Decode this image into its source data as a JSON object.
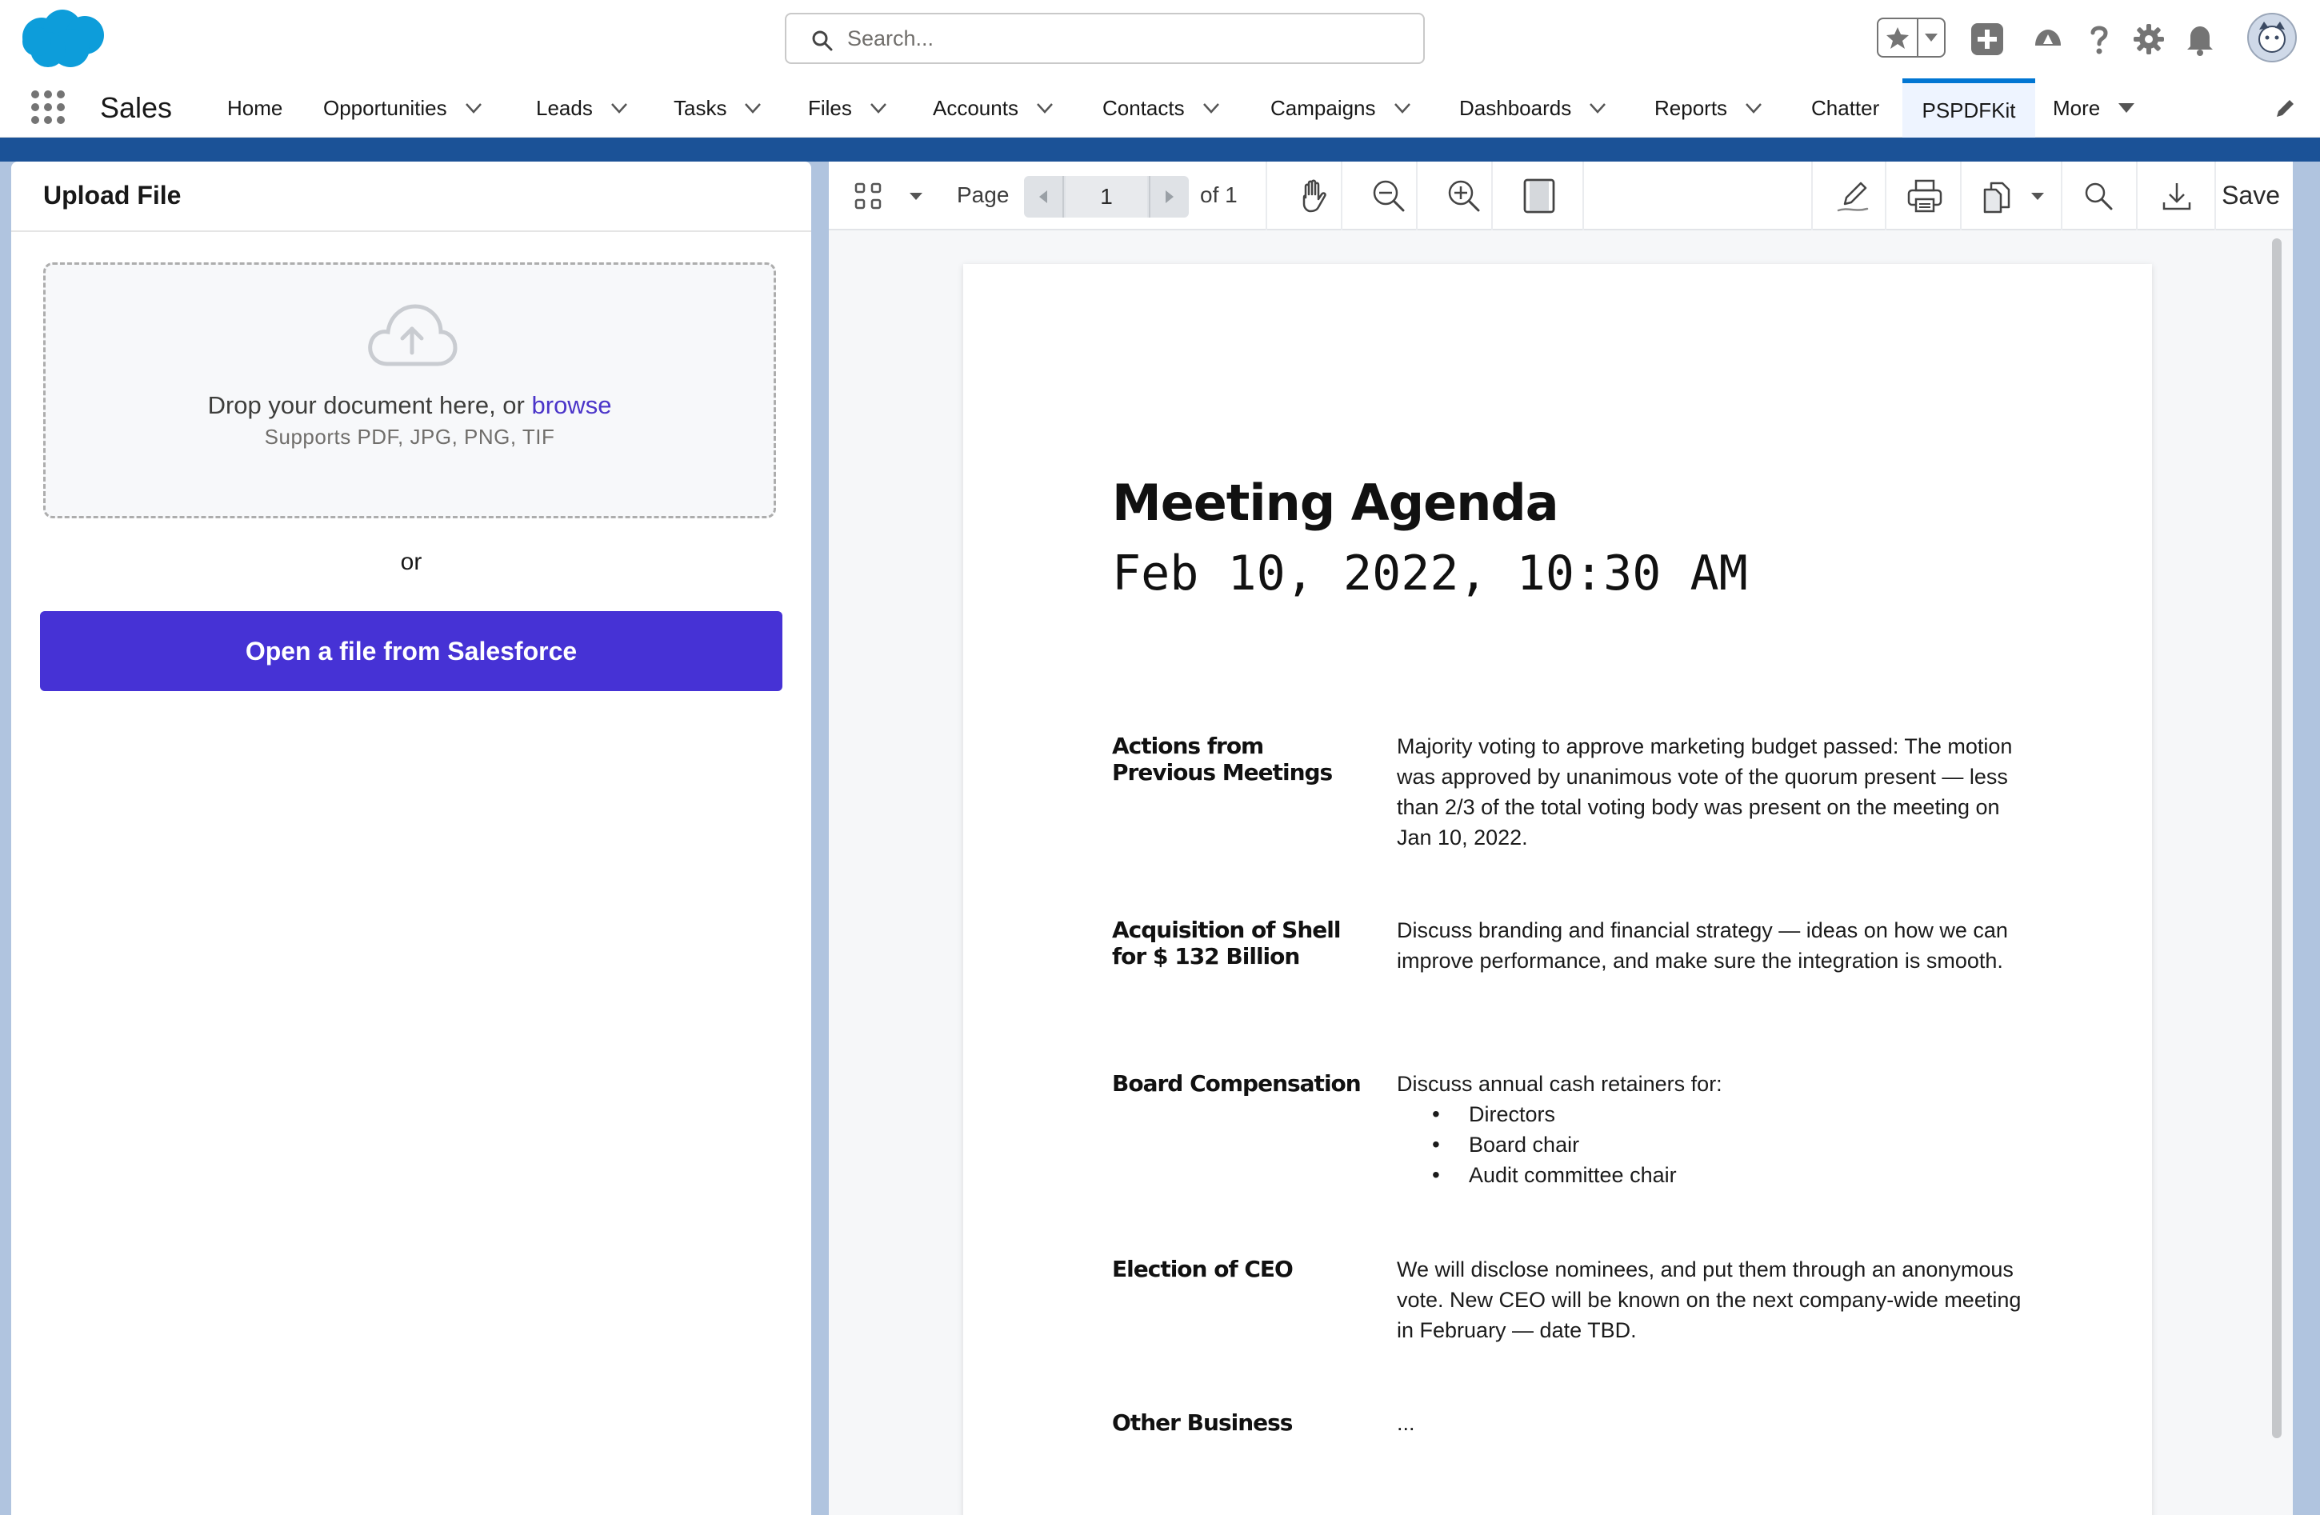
{
  "header": {
    "search_placeholder": "Search...",
    "icons": [
      "favorites-star-icon",
      "favorites-dropdown-icon",
      "global-actions-plus-icon",
      "trailhead-icon",
      "help-icon",
      "setup-gear-icon",
      "notifications-bell-icon",
      "user-avatar"
    ]
  },
  "nav": {
    "app_name": "Sales",
    "items": [
      {
        "label": "Home",
        "dropdown": false
      },
      {
        "label": "Opportunities",
        "dropdown": true
      },
      {
        "label": "Leads",
        "dropdown": true
      },
      {
        "label": "Tasks",
        "dropdown": true
      },
      {
        "label": "Files",
        "dropdown": true
      },
      {
        "label": "Accounts",
        "dropdown": true
      },
      {
        "label": "Contacts",
        "dropdown": true
      },
      {
        "label": "Campaigns",
        "dropdown": true
      },
      {
        "label": "Dashboards",
        "dropdown": true
      },
      {
        "label": "Reports",
        "dropdown": true
      },
      {
        "label": "Chatter",
        "dropdown": false
      },
      {
        "label": "PSPDFKit",
        "dropdown": false,
        "active": true
      },
      {
        "label": "More",
        "dropdown": true
      }
    ]
  },
  "upload": {
    "title": "Upload File",
    "drop_text": "Drop your document here, or ",
    "browse_link": "browse",
    "supports": "Supports PDF, JPG, PNG, TIF",
    "or": "or",
    "open_button": "Open a file from Salesforce"
  },
  "viewer": {
    "page_label": "Page",
    "current_page": "1",
    "page_of": "of 1",
    "save_label": "Save"
  },
  "document": {
    "title": "Meeting Agenda",
    "date": "Feb 10, 2022, 10:30 AM",
    "rows": [
      {
        "label": "Actions from Previous Meetings",
        "text": "Majority voting to approve marketing budget passed: The motion was approved by unanimous vote of the quorum present — less than 2/3 of the total voting body was present on the meeting on Jan 10, 2022."
      },
      {
        "label": "Acquisition of Shell for $ 132 Billion",
        "text": "Discuss branding and financial strategy — ideas on how we can improve performance, and make sure the integration is smooth."
      },
      {
        "label": "Board Compensation",
        "text": "Discuss annual cash retainers for:",
        "bullets": [
          "Directors",
          "Board chair",
          "Audit committee chair"
        ]
      },
      {
        "label": "Election of CEO",
        "text": "We will disclose nominees, and put them through an anonymous vote. New CEO will be known on the next company-wide meeting in February — date TBD."
      },
      {
        "label": "Other Business",
        "text": "..."
      }
    ]
  },
  "colors": {
    "brand_blue": "#0176d3",
    "primary_button": "#4632d5",
    "browse_link": "#4b35c9",
    "band": "#1b5297"
  }
}
